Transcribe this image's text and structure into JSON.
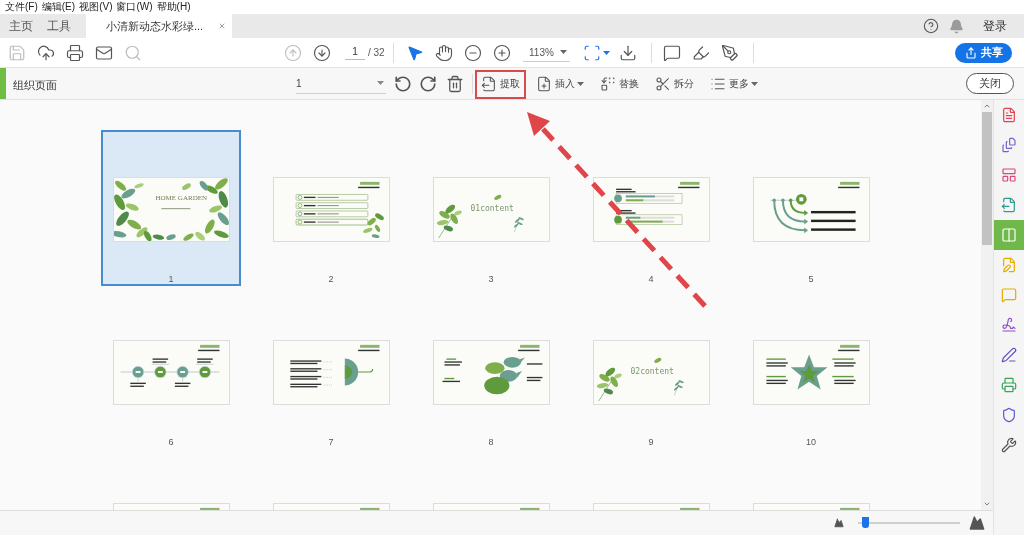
{
  "menu_bar": [
    "文件(F)",
    "编辑(E)",
    "视图(V)",
    "窗口(W)",
    "帮助(H)"
  ],
  "tabs": [
    {
      "label": "主页",
      "selected": false,
      "closable": false
    },
    {
      "label": "工具",
      "selected": false,
      "closable": false
    },
    {
      "label": "小清新动态水彩绿...",
      "selected": true,
      "closable": true
    }
  ],
  "header_right": {
    "sign_in": "登录"
  },
  "toolbar": {
    "file_tools": [
      {
        "disabled": true
      },
      {
        "disabled": false
      },
      {
        "disabled": false
      },
      {
        "disabled": false
      },
      {
        "disabled": true
      }
    ],
    "page_nav": [
      {
        "disabled": true
      },
      {
        "disabled": false
      }
    ],
    "page_input": "1",
    "page_total": "/ 32",
    "zoom": "113%",
    "share_button": "共享"
  },
  "organize_bar": {
    "title": "组织页面",
    "page_select": "1",
    "actions": [
      {
        "label": "提取",
        "has_menu": false,
        "highlighted": true
      },
      {
        "label": "插入",
        "has_menu": true,
        "highlighted": false
      },
      {
        "label": "替换",
        "has_menu": false,
        "highlighted": false
      },
      {
        "label": "拆分",
        "has_menu": false,
        "highlighted": false
      },
      {
        "label": "更多",
        "has_menu": true,
        "highlighted": false
      }
    ],
    "close_button": "关闭"
  },
  "pages": [
    {
      "label": "1",
      "selected": true,
      "kind": "cover",
      "title": "HOME GARDEN"
    },
    {
      "label": "2",
      "selected": false,
      "kind": "list"
    },
    {
      "label": "3",
      "selected": false,
      "kind": "section",
      "title": "01content"
    },
    {
      "label": "4",
      "selected": false,
      "kind": "bars"
    },
    {
      "label": "5",
      "selected": false,
      "kind": "arrows"
    },
    {
      "label": "6",
      "selected": false,
      "kind": "timeline"
    },
    {
      "label": "7",
      "selected": false,
      "kind": "umbrella"
    },
    {
      "label": "8",
      "selected": false,
      "kind": "birds"
    },
    {
      "label": "9",
      "selected": false,
      "kind": "section",
      "title": "02content"
    },
    {
      "label": "10",
      "selected": false,
      "kind": "star"
    },
    {
      "selected": false,
      "kind": "plain"
    },
    {
      "selected": false,
      "kind": "plain"
    },
    {
      "selected": false,
      "kind": "plain"
    },
    {
      "selected": false,
      "kind": "plain"
    },
    {
      "selected": false,
      "kind": "plain"
    }
  ],
  "right_tools": [
    {
      "selected": false
    },
    {
      "selected": false
    },
    {
      "selected": false
    },
    {
      "selected": false
    },
    {
      "selected": true
    },
    {
      "selected": false
    },
    {
      "selected": false
    },
    {
      "selected": false
    },
    {
      "selected": false
    },
    {
      "selected": false
    },
    {
      "selected": false
    },
    {
      "selected": false
    }
  ],
  "thumbnail_size": {
    "level": 0.04
  }
}
